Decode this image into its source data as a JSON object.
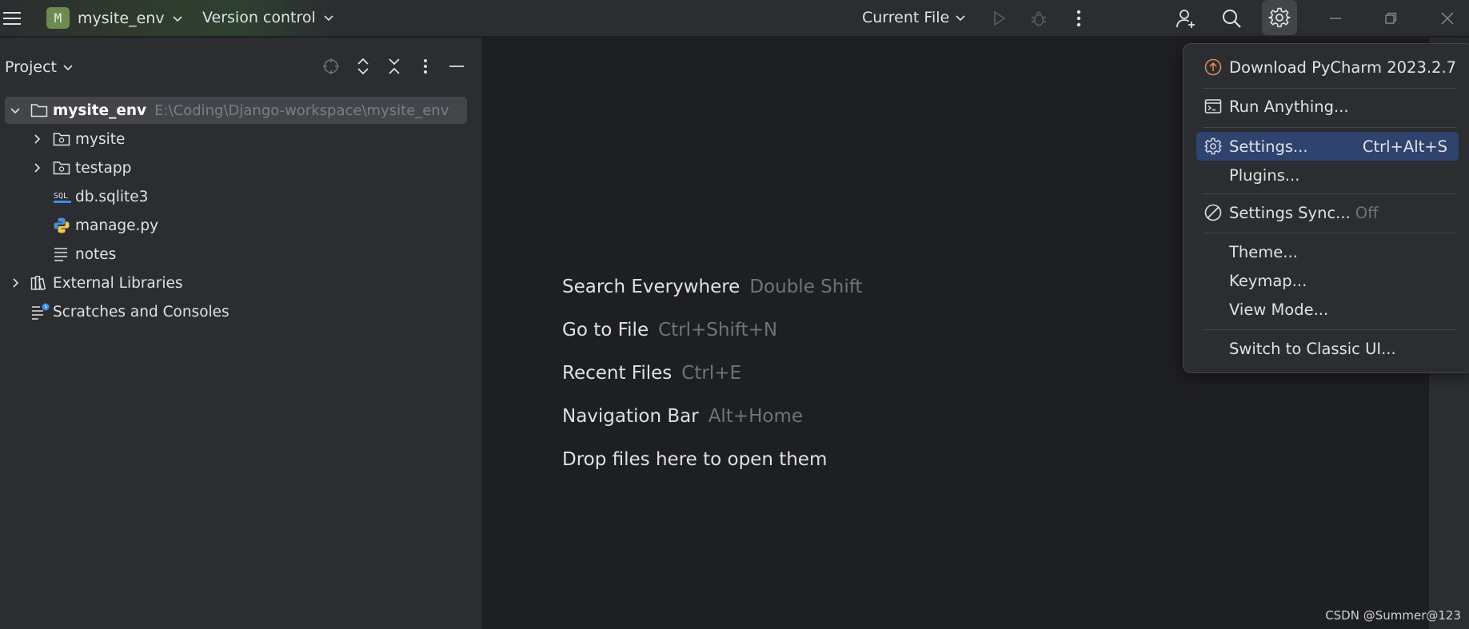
{
  "titlebar": {
    "project_badge": "M",
    "project_name": "mysite_env",
    "vcs_label": "Version control",
    "run_config": "Current File",
    "icons": [
      "hamburger-icon",
      "chevron-down-icon",
      "run-icon",
      "debug-icon",
      "more-vertical-icon",
      "add-user-icon",
      "search-icon",
      "gear-icon",
      "minimize-icon",
      "restore-icon",
      "close-icon"
    ]
  },
  "project_panel": {
    "title": "Project",
    "tree": [
      {
        "label": "mysite_env",
        "path": "E:\\Coding\\Django-workspace\\mysite_env",
        "icon": "folder-icon"
      },
      {
        "label": "mysite",
        "icon": "module-folder-icon"
      },
      {
        "label": "testapp",
        "icon": "module-folder-icon"
      },
      {
        "label": "db.sqlite3",
        "icon": "sql-file-icon"
      },
      {
        "label": "manage.py",
        "icon": "python-file-icon"
      },
      {
        "label": "notes",
        "icon": "text-file-icon"
      },
      {
        "label": "External Libraries",
        "icon": "libraries-icon"
      },
      {
        "label": "Scratches and Consoles",
        "icon": "scratches-icon"
      }
    ]
  },
  "editor": {
    "hints": [
      {
        "action": "Search Everywhere",
        "key": "Double Shift"
      },
      {
        "action": "Go to File",
        "key": "Ctrl+Shift+N"
      },
      {
        "action": "Recent Files",
        "key": "Ctrl+E"
      },
      {
        "action": "Navigation Bar",
        "key": "Alt+Home"
      },
      {
        "action": "Drop files here to open them",
        "key": ""
      }
    ]
  },
  "settings_menu": {
    "items": [
      {
        "label": "Download PyCharm 2023.2.7",
        "icon": "update-icon"
      },
      {
        "label": "Run Anything...",
        "icon": "run-anything-icon"
      },
      {
        "label": "Settings...",
        "shortcut": "Ctrl+Alt+S",
        "icon": "gear-icon",
        "active": true
      },
      {
        "label": "Plugins..."
      },
      {
        "label": "Settings Sync...",
        "muted": "Off",
        "icon": "sync-off-icon"
      },
      {
        "label": "Theme..."
      },
      {
        "label": "Keymap..."
      },
      {
        "label": "View Mode..."
      },
      {
        "label": "Switch to Classic UI..."
      }
    ]
  },
  "watermark": "CSDN @Summer@123",
  "colors": {
    "accent": "#2e436e",
    "badge": "#6e8a52",
    "update": "#e08855"
  }
}
